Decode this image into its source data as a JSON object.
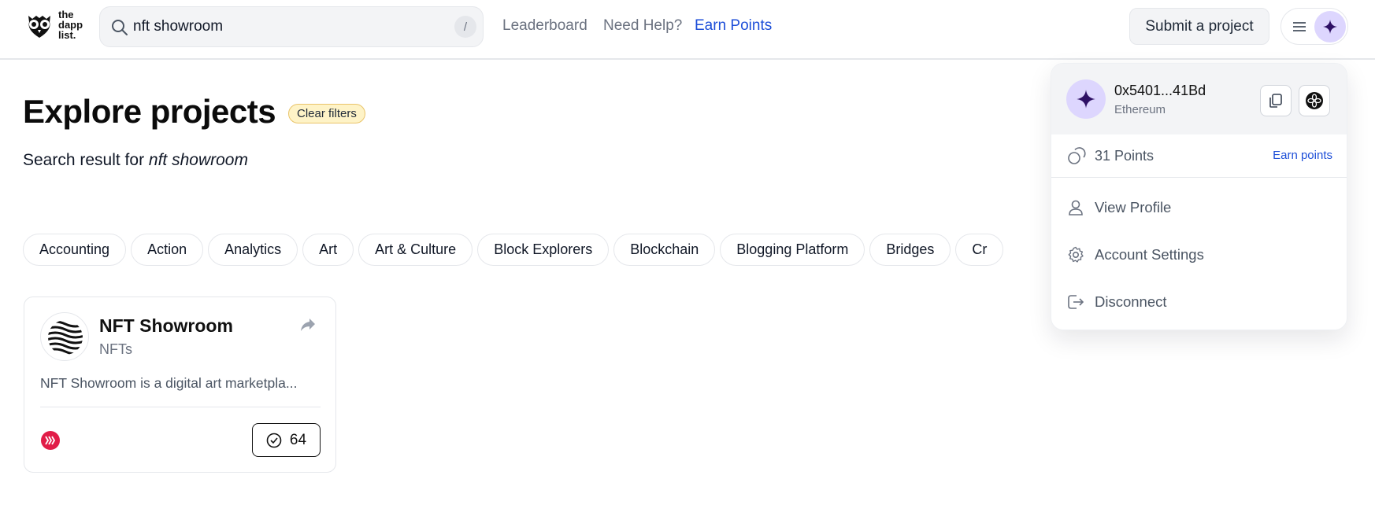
{
  "header": {
    "logo": {
      "line1": "the",
      "line2": "dapp",
      "line3": "list."
    },
    "search": {
      "value": "nft showroom",
      "placeholder": "",
      "shortcut": "/"
    },
    "nav": [
      {
        "label": "Leaderboard"
      },
      {
        "label": "Need Help?"
      },
      {
        "label": "Earn Points"
      }
    ],
    "submit_label": "Submit a project"
  },
  "main": {
    "title": "Explore projects",
    "clear_filters_label": "Clear filters",
    "result_prefix": "Search result for",
    "result_query": "nft showroom",
    "categories": [
      "Accounting",
      "Action",
      "Analytics",
      "Art",
      "Art & Culture",
      "Block Explorers",
      "Blockchain",
      "Blogging Platform",
      "Bridges",
      "Cr"
    ]
  },
  "card": {
    "title": "NFT Showroom",
    "category": "NFTs",
    "description": "NFT Showroom is a digital art marketpla...",
    "vote_count": "64"
  },
  "dropdown": {
    "address": "0x5401...41Bd",
    "network": "Ethereum",
    "points_label": "31 Points",
    "earn_points_label": "Earn points",
    "items": [
      {
        "label": "View Profile"
      },
      {
        "label": "Account Settings"
      },
      {
        "label": "Disconnect"
      }
    ]
  },
  "colors": {
    "accent_link": "#1d4ed8",
    "avatar_bg": "#ddd6fe",
    "avatar_star": "#2e1065",
    "clear_filters_bg": "#fef3c7",
    "chain_badge": "#e11d48"
  }
}
